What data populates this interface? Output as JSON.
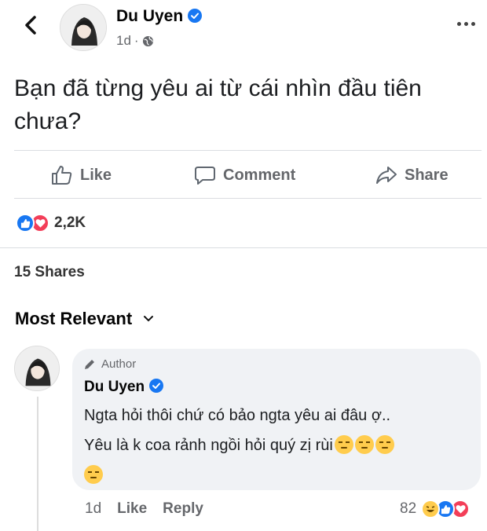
{
  "header": {
    "author": "Du Uyen",
    "time": "1d",
    "separator": "·",
    "icons": {
      "back": "chevron-left-icon",
      "verified": "verified-icon",
      "audience": "globe-icon",
      "more": "more-icon"
    }
  },
  "post": {
    "text": "Bạn đã từng yêu ai từ cái nhìn đầu tiên chưa?"
  },
  "actions": {
    "like": "Like",
    "comment": "Comment",
    "share": "Share"
  },
  "reactions": {
    "count": "2,2K",
    "types": [
      "like",
      "love"
    ]
  },
  "shares": "15 Shares",
  "sort": {
    "label": "Most Relevant"
  },
  "comment": {
    "badge": "Author",
    "name": "Du Uyen",
    "line1": "Ngta hỏi thôi chứ có bảo ngta yêu ai đâu ợ..",
    "line2": "Yêu là k coa rảnh ngồi hỏi quý zị rùi",
    "time": "1d",
    "like": "Like",
    "reply": "Reply",
    "reaction_count": "82",
    "reaction_types": [
      "haha",
      "like",
      "love"
    ]
  },
  "colors": {
    "facebook_blue": "#1877f2",
    "love_red": "#f33e58",
    "secondary_text": "#65676b",
    "bubble_bg": "#f0f2f5"
  }
}
